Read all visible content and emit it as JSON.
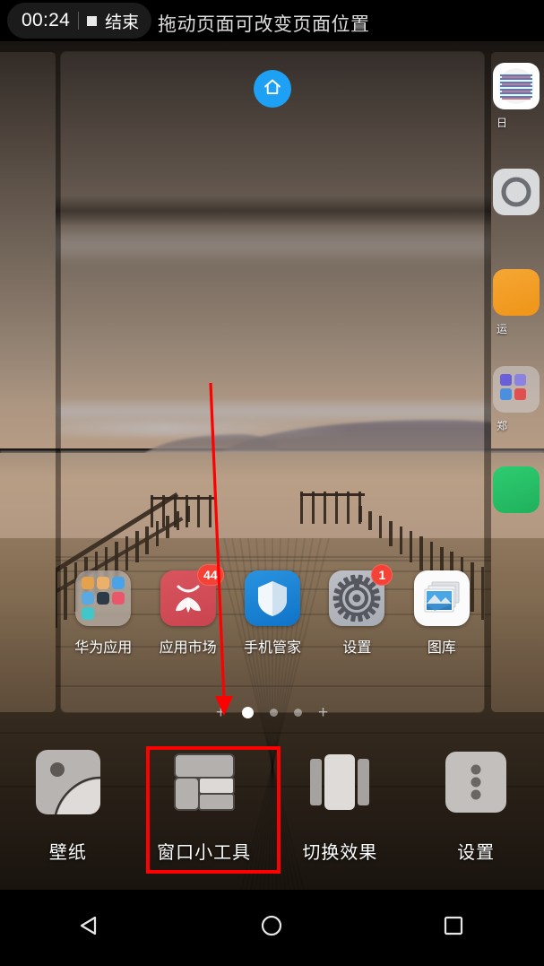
{
  "statusbar": {
    "recording_time": "00:24",
    "end_label": "结束",
    "stop_icon": "stop-square-icon"
  },
  "hint": {
    "text": "拖动页面可改变页面位置"
  },
  "page_preview": {
    "home_badge_icon": "home-icon",
    "home_badge_color": "#1ea0f5"
  },
  "dock": {
    "apps": [
      {
        "label": "华为应用",
        "icon": "folder-icon",
        "badge": ""
      },
      {
        "label": "应用市场",
        "icon": "huawei-appgallery-icon",
        "badge": "44"
      },
      {
        "label": "手机管家",
        "icon": "shield-icon",
        "badge": ""
      },
      {
        "label": "设置",
        "icon": "gear-icon",
        "badge": "1"
      },
      {
        "label": "图库",
        "icon": "photo-stack-icon",
        "badge": ""
      }
    ]
  },
  "side_pages": {
    "right_icons": [
      {
        "label": "日",
        "icon": "calendar-icon"
      },
      {
        "label": "",
        "icon": "gray-circle-icon"
      },
      {
        "label": "运",
        "icon": "orange-app-icon"
      },
      {
        "label": "郑",
        "icon": "folder-icon"
      },
      {
        "label": "",
        "icon": "green-app-icon"
      }
    ]
  },
  "page_indicator": {
    "add_left": "+",
    "add_right": "+",
    "dots": 3,
    "active_index": 0
  },
  "toolbar": {
    "items": [
      {
        "label": "壁纸",
        "icon": "wallpaper-icon",
        "selected": false
      },
      {
        "label": "窗口小工具",
        "icon": "widgets-icon",
        "selected": true
      },
      {
        "label": "切换效果",
        "icon": "transition-effect-icon",
        "selected": false
      },
      {
        "label": "设置",
        "icon": "more-dots-icon",
        "selected": false
      }
    ],
    "highlight_color": "#ff0000"
  },
  "navbar": {
    "back_icon": "back-triangle-icon",
    "home_icon": "home-circle-icon",
    "recents_icon": "recents-square-icon"
  },
  "annotation": {
    "arrow_color": "#ff0000",
    "arrow_from": "(235, 427)",
    "arrow_to": "(250, 795)"
  }
}
